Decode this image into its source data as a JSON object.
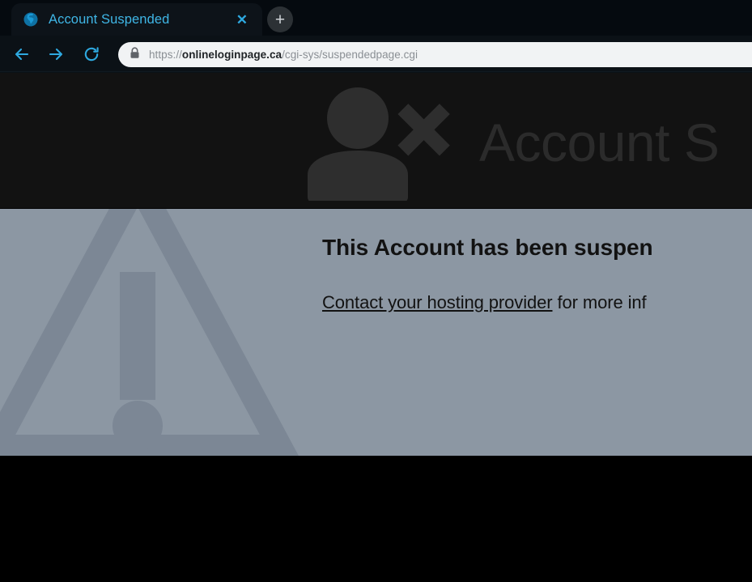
{
  "browser": {
    "tab": {
      "title": "Account Suspended",
      "favicon": "globe-icon",
      "close_label": "✕"
    },
    "new_tab_label": "+",
    "nav": {
      "back_label": "back-arrow-icon",
      "forward_label": "forward-arrow-icon",
      "reload_label": "reload-icon"
    },
    "omnibox": {
      "security_icon": "lock-icon",
      "scheme": "https://",
      "host": "onlineloginpage.ca",
      "path": "/cgi-sys/suspendedpage.cgi",
      "full_url": "https://onlineloginpage.ca/cgi-sys/suspendedpage.cgi"
    }
  },
  "page": {
    "header": {
      "icon": "user-remove-icon",
      "title": "Account S"
    },
    "body": {
      "warning_icon": "warning-triangle-icon",
      "headline": "This Account has been suspen",
      "link_text": "Contact your hosting provider",
      "trailing_text": " for more inf"
    }
  },
  "colors": {
    "tab_accent": "#3fb6e6",
    "chrome_dark": "#0b1116",
    "omnibox_bg": "#f1f3f4",
    "page_header_bg": "#121212",
    "page_body_bg": "#8c97a3",
    "triangle_fill": "#7c8795",
    "header_title": "#2b2b2b"
  }
}
